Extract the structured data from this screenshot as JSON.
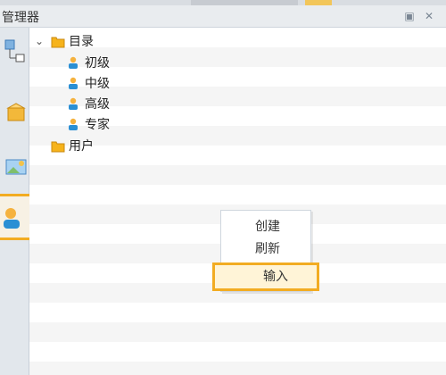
{
  "header": {
    "title": "管理器"
  },
  "tree": {
    "nodes": [
      {
        "label": "目录",
        "icon": "folder-icon"
      },
      {
        "label": "初级",
        "icon": "user-icon"
      },
      {
        "label": "中级",
        "icon": "user-icon"
      },
      {
        "label": "高级",
        "icon": "user-icon"
      },
      {
        "label": "专家",
        "icon": "user-icon"
      },
      {
        "label": "用户",
        "icon": "folder-icon"
      }
    ]
  },
  "context_menu": {
    "items": [
      {
        "label": "创建"
      },
      {
        "label": "刷新"
      },
      {
        "label": "输入"
      }
    ]
  },
  "colors": {
    "highlight": "#f2ac22",
    "menu_hover": "#fff4d7",
    "folder": "#f6b31b",
    "user": "#2a8fd4"
  }
}
